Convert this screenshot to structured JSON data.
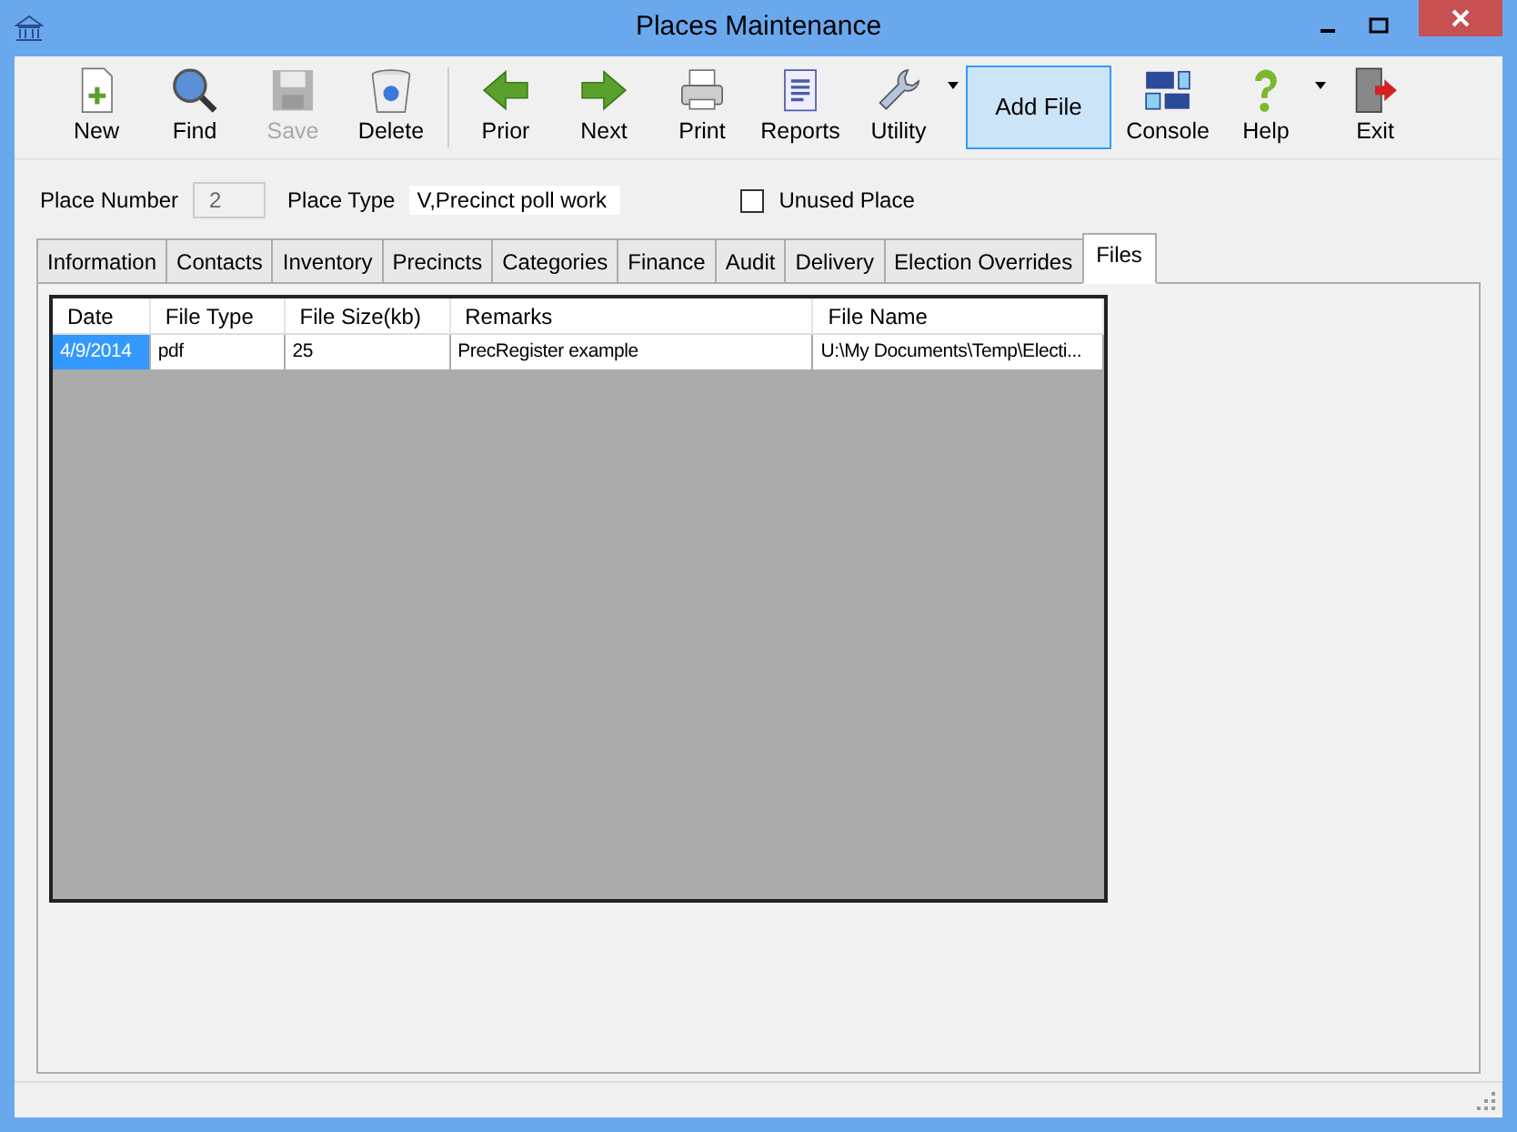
{
  "window": {
    "title": "Places Maintenance"
  },
  "toolbar": [
    {
      "kind": "button",
      "label": "New",
      "disabled": false
    },
    {
      "kind": "button",
      "label": "Find",
      "disabled": false
    },
    {
      "kind": "button",
      "label": "Save",
      "disabled": true
    },
    {
      "kind": "button",
      "label": "Delete",
      "disabled": false
    },
    {
      "kind": "separator"
    },
    {
      "kind": "button",
      "label": "Prior",
      "disabled": false
    },
    {
      "kind": "button",
      "label": "Next",
      "disabled": false
    },
    {
      "kind": "button",
      "label": "Print",
      "disabled": false
    },
    {
      "kind": "button",
      "label": "Reports",
      "disabled": false
    },
    {
      "kind": "dropdown",
      "label": "Utility",
      "disabled": false
    },
    {
      "kind": "highlighted",
      "label": "Add File",
      "disabled": false
    },
    {
      "kind": "button",
      "label": "Console",
      "disabled": false
    },
    {
      "kind": "dropdown",
      "label": "Help",
      "disabled": false
    },
    {
      "kind": "button",
      "label": "Exit",
      "disabled": false
    }
  ],
  "fields": {
    "place_number_label": "Place Number",
    "place_number": "2",
    "place_type_label": "Place Type",
    "place_type": "V,Precinct poll work",
    "unused_label": "Unused Place",
    "unused_checked": false
  },
  "tabs": [
    {
      "label": "Information",
      "selected": false
    },
    {
      "label": "Contacts",
      "selected": false
    },
    {
      "label": "Inventory",
      "selected": false
    },
    {
      "label": "Precincts",
      "selected": false
    },
    {
      "label": "Categories",
      "selected": false
    },
    {
      "label": "Finance",
      "selected": false
    },
    {
      "label": "Audit",
      "selected": false
    },
    {
      "label": "Delivery",
      "selected": false
    },
    {
      "label": "Election Overrides",
      "selected": false
    },
    {
      "label": "Files",
      "selected": true
    }
  ],
  "table": {
    "columns": [
      "Date",
      "File Type",
      "File Size(kb)",
      "Remarks",
      "File Name"
    ],
    "rows": [
      {
        "cells": [
          {
            "text": "4/9/2014",
            "selected": true
          },
          {
            "text": "pdf",
            "selected": false
          },
          {
            "text": "25",
            "selected": false
          },
          {
            "text": "PrecRegister example",
            "selected": false
          },
          {
            "text": "U:\\My Documents\\Temp\\Electi...",
            "selected": false
          }
        ]
      }
    ]
  }
}
